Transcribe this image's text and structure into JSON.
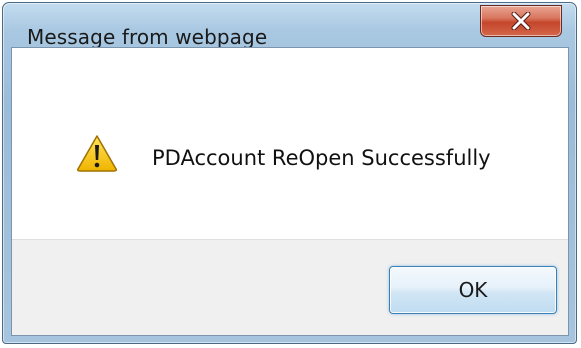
{
  "dialog": {
    "title": "Message from webpage",
    "message": "PDAccount ReOpen Successfully",
    "ok_label": "OK",
    "close_icon": "close-x-icon",
    "message_icon": "warning-triangle-icon"
  },
  "colors": {
    "close_button": "#c4462b",
    "warning_fill": "#f5c400",
    "ok_border": "#3c7fb1"
  }
}
